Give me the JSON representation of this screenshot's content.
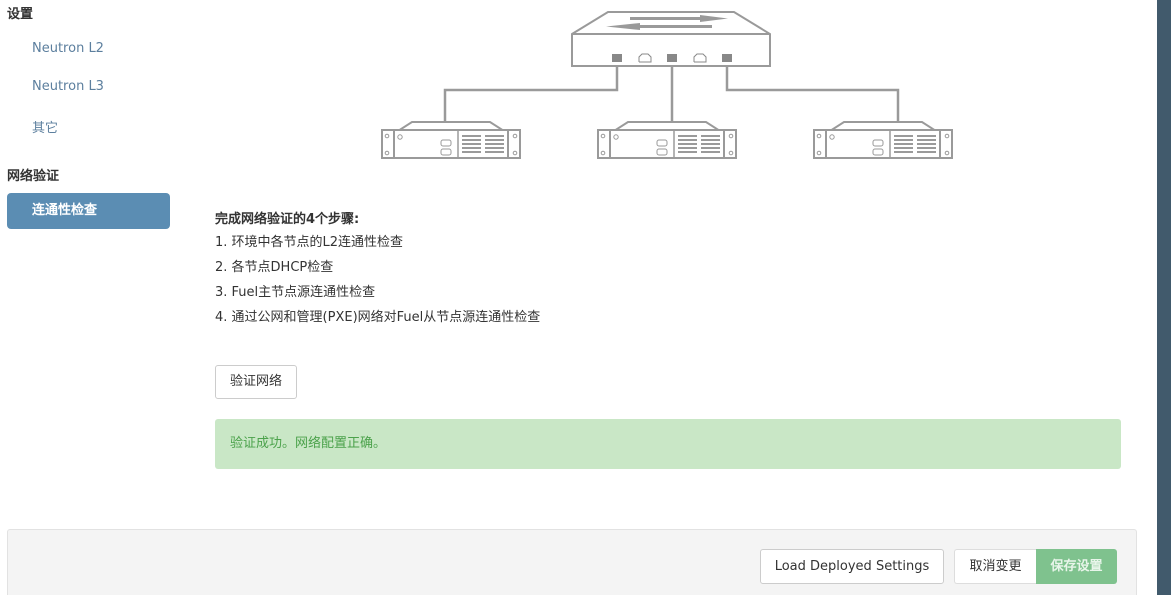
{
  "sidebar": {
    "group_settings": "设置",
    "items": [
      {
        "label": "Neutron L2"
      },
      {
        "label": "Neutron L3"
      },
      {
        "label": "其它"
      }
    ],
    "group_network_verification": "网络验证",
    "active_item": "连通性检查"
  },
  "diagram": {
    "icons": [
      "network-switch-icon",
      "server-icon",
      "server-icon",
      "server-icon"
    ]
  },
  "main": {
    "steps_title": "完成网络验证的4个步骤:",
    "steps": [
      "1. 环境中各节点的L2连通性检查",
      "2. 各节点DHCP检查",
      "3. Fuel主节点源连通性检查",
      "4. 通过公网和管理(PXE)网络对Fuel从节点源连通性检查"
    ],
    "verify_button": "验证网络",
    "alert_success": "验证成功。网络配置正确。"
  },
  "footer": {
    "load_deployed_settings": "Load Deployed Settings",
    "cancel_changes": "取消变更",
    "save_settings": "保存设置"
  },
  "colors": {
    "sidebar_active_bg": "#5b8db3",
    "sidebar_link": "#5c7f9e",
    "alert_bg": "#c9e7c6",
    "alert_text": "#4ba24b",
    "save_button_bg": "#7fc28e",
    "right_strip": "#415a6c"
  }
}
